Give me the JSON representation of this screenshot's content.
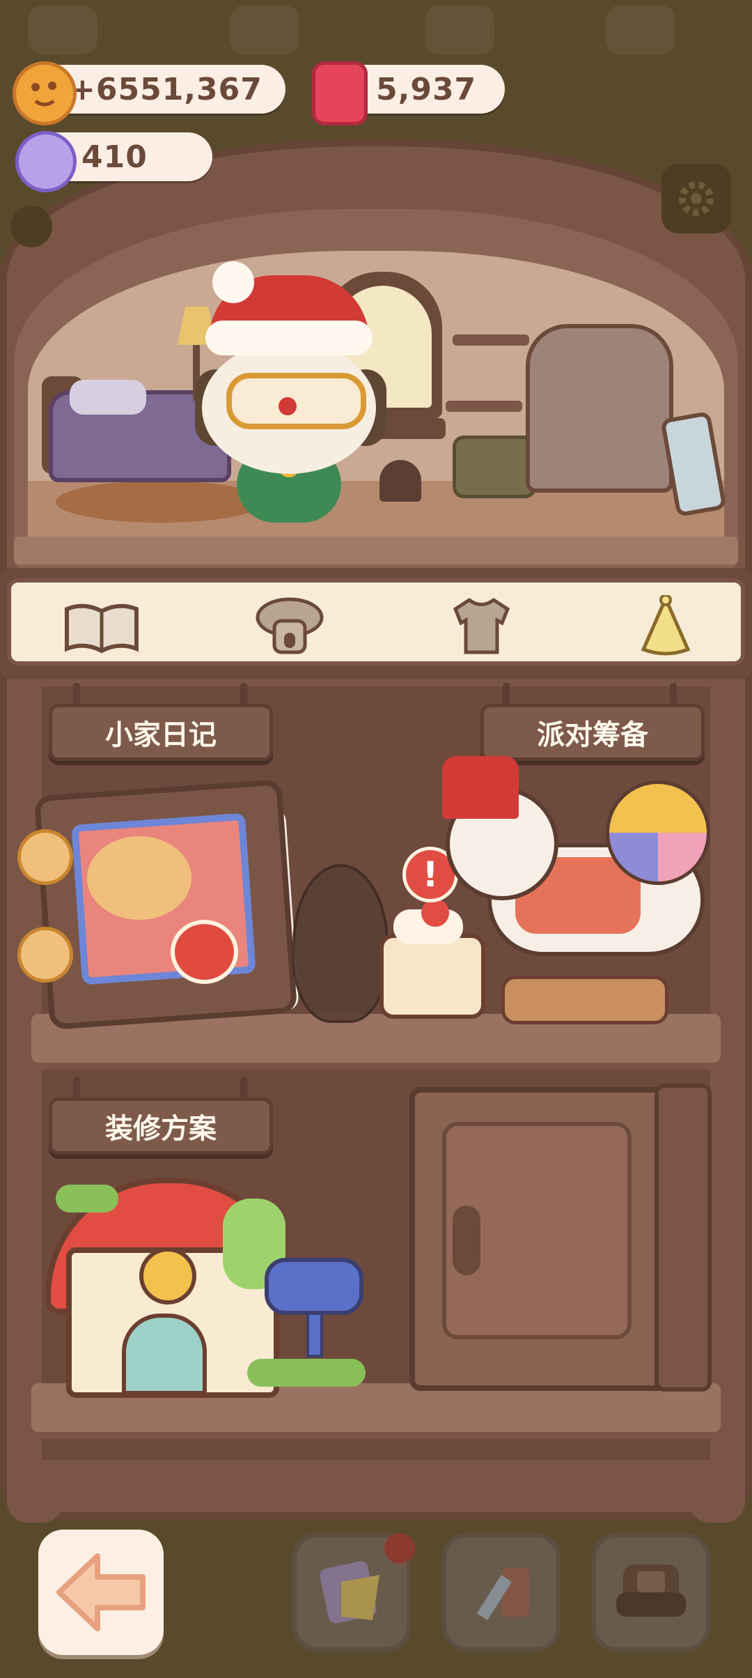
{
  "currencies": {
    "cookies": {
      "icon": "cookie-icon",
      "value": "+6551,367"
    },
    "gems": {
      "icon": "red-gem-icon",
      "value": "5,937"
    },
    "candy": {
      "icon": "candy-icon",
      "value": "410"
    }
  },
  "tabs": [
    {
      "icon": "diary-book-icon",
      "selected": false
    },
    {
      "icon": "hotel-icon",
      "selected": false
    },
    {
      "icon": "shirt-icon",
      "selected": false
    },
    {
      "icon": "party-hat-icon",
      "selected": true
    }
  ],
  "sections": {
    "diary": {
      "label": "小家日记"
    },
    "party": {
      "label": "派对筹备"
    },
    "decor": {
      "label": "装修方案"
    }
  },
  "alert_badge": "!",
  "bottom_bar": [
    {
      "icon": "back-arrow-icon"
    },
    {
      "icon": "paint-icon"
    },
    {
      "icon": "build-icon"
    },
    {
      "icon": "furniture-icon"
    }
  ],
  "colors": {
    "accent": "#d23a36",
    "panel": "#fbeee4",
    "wood": "#7b5646"
  }
}
